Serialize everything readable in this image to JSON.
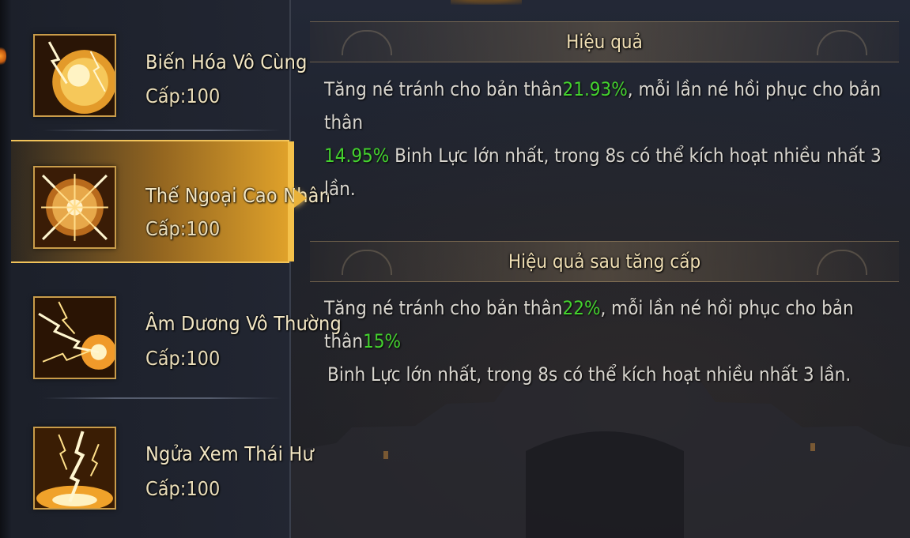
{
  "skills": [
    {
      "name": "Biến Hóa Vô Cùng",
      "level": "Cấp:100",
      "icon": "lightning-orb-icon",
      "selected": false
    },
    {
      "name": "Thế Ngoại Cao Nhân",
      "level": "Cấp:100",
      "icon": "radiant-sphere-icon",
      "selected": true
    },
    {
      "name": "Âm Dương Vô Thường",
      "level": "Cấp:100",
      "icon": "lightning-burst-icon",
      "selected": false
    },
    {
      "name": "Ngửa Xem Thái Hư",
      "level": "Cấp:100",
      "icon": "lightning-strike-icon",
      "selected": false
    }
  ],
  "effect": {
    "title": "Hiệu quả",
    "line1_a": "Tăng né tránh cho bản thân",
    "line1_value": "21.93%",
    "line1_b": ", mỗi lần né hồi phục cho bản thân",
    "line2_value": "14.95%",
    "line2_b": " Binh Lực lớn nhất, trong 8s có thể kích hoạt nhiều nhất 3 lần."
  },
  "upgrade": {
    "title": "Hiệu quả sau tăng cấp",
    "line1_a": "Tăng né tránh cho bản thân",
    "line1_value": "22%",
    "line1_b": ", mỗi lần né hồi phục cho bản thân",
    "line1_value2": "15%",
    "line2_b": " Binh Lực lớn nhất, trong 8s có thể kích hoạt nhiều nhất 3 lần."
  },
  "colors": {
    "highlight": "#44d22e",
    "gold": "#e0a22a",
    "text": "#d9d6cf"
  }
}
